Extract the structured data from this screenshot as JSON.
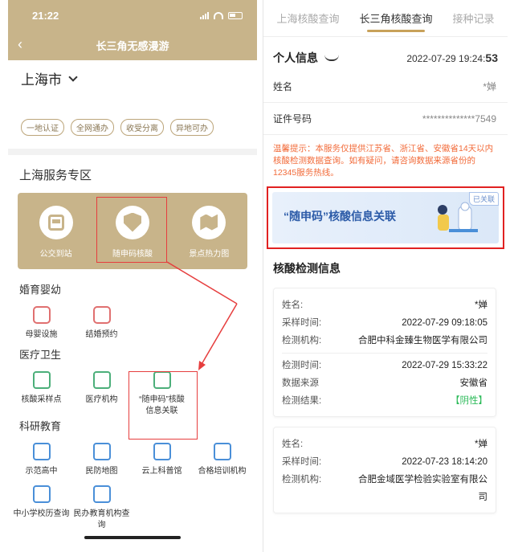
{
  "left": {
    "status_time": "21:22",
    "nav_title": "长三角无感漫游",
    "city": "上海市",
    "tags": [
      "一地认证",
      "全网通办",
      "收受分离",
      "异地可办"
    ],
    "section_title": "上海服务专区",
    "featured": [
      "公交到站",
      "随申码核酸",
      "景点热力图"
    ],
    "categories": [
      {
        "title": "婚育婴幼",
        "items": [
          "母婴设施",
          "结婚预约"
        ]
      },
      {
        "title": "医疗卫生",
        "items": [
          "核酸采样点",
          "医疗机构",
          "“随申码”核酸\n信息关联"
        ]
      },
      {
        "title": "科研教育",
        "items": [
          "示范高中",
          "民防地图",
          "云上科普馆",
          "合格培训机构",
          "中小学校历查询",
          "民办教育机构查询"
        ]
      }
    ]
  },
  "right": {
    "tabs": [
      "上海核酸查询",
      "长三角核酸查询",
      "接种记录"
    ],
    "active_tab": "长三角核酸查询",
    "personal_title": "个人信息",
    "datetime_prefix": "2022-07-29 19:24:",
    "datetime_seconds": "53",
    "name_label": "姓名",
    "name_value": "*婵",
    "id_label": "证件号码",
    "id_value": "**************7549",
    "warning": "温馨提示：本服务仅提供江苏省、浙江省、安徽省14天以内核酸检测数据查询。如有疑问，请咨询数据来源省份的12345服务热线。",
    "banner_text": "“随申码”核酸信息关联",
    "banner_badge": "已关联",
    "nat_title": "核酸检测信息",
    "records": [
      {
        "name_k": "姓名:",
        "name_v": "*婵",
        "sample_k": "采样时间:",
        "sample_v": "2022-07-29 09:18:05",
        "org_k": "检测机构:",
        "org_v": "合肥中科金臻生物医学有限公司",
        "test_k": "检测时间:",
        "test_v": "2022-07-29 15:33:22",
        "src_k": "数据来源",
        "src_v": "安徽省",
        "res_k": "检测结果:",
        "res_v": "【阴性】"
      },
      {
        "name_k": "姓名:",
        "name_v": "*婵",
        "sample_k": "采样时间:",
        "sample_v": "2022-07-23 18:14:20",
        "org_k": "检测机构:",
        "org_v": "合肥金域医学检验实验室有限公司"
      }
    ]
  },
  "colors": {
    "gold": "#c8b48a",
    "highlight_red": "#e63e3e",
    "warning_orange": "#f26b3a",
    "negative_green": "#2dbb5a"
  }
}
